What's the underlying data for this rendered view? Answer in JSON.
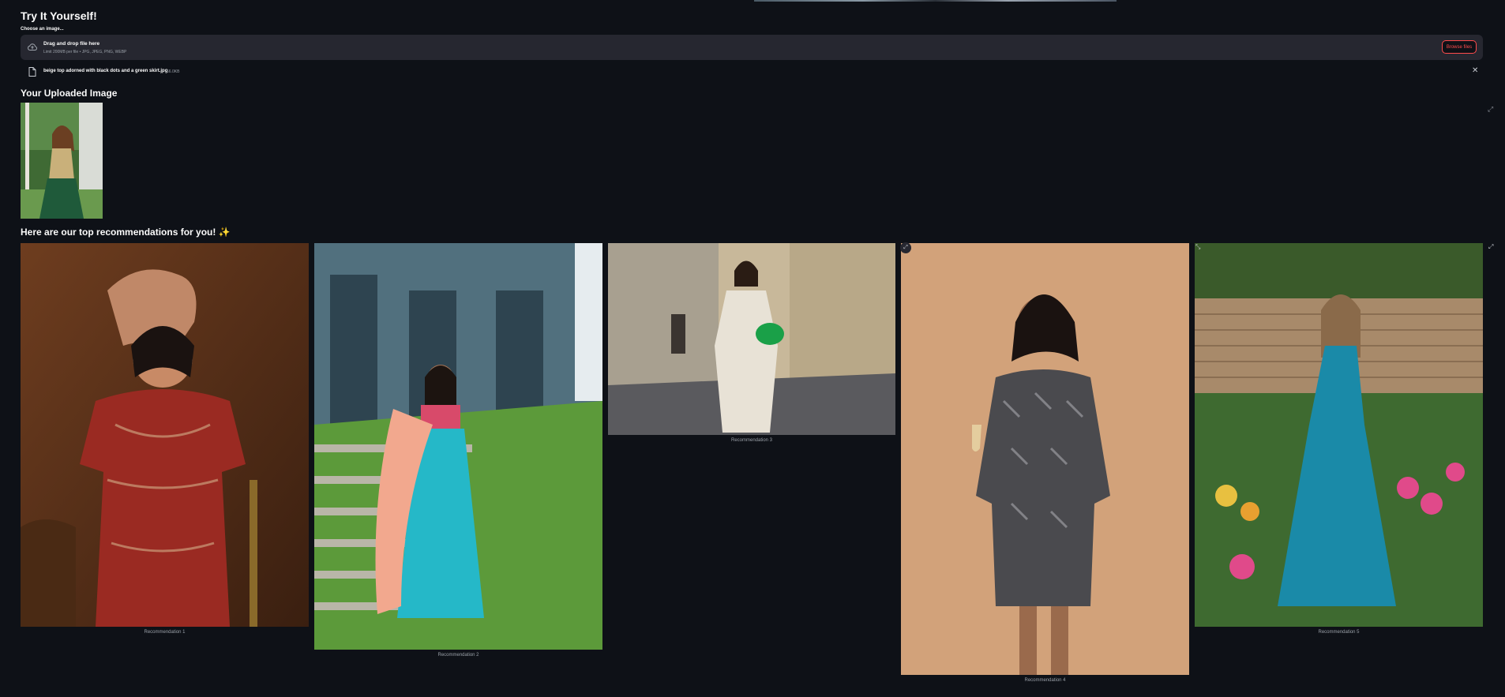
{
  "header": {
    "title": "Try It Yourself!"
  },
  "uploader": {
    "label": "Choose an image...",
    "drop_title": "Drag and drop file here",
    "drop_sub": "Limit 200MB per file • JPG, JPEG, PNG, WEBP",
    "browse_label": "Browse files",
    "file": {
      "name": "beige top adorned with black dots and a green skirt.jpg",
      "size": "56.0KB"
    },
    "close_symbol": "✕"
  },
  "uploaded": {
    "heading": "Your Uploaded Image"
  },
  "recommendations": {
    "heading": "Here are our top recommendations for you! ✨",
    "items": [
      {
        "caption": "Recommendation 1"
      },
      {
        "caption": "Recommendation 2"
      },
      {
        "caption": "Recommendation 3"
      },
      {
        "caption": "Recommendation 4"
      },
      {
        "caption": "Recommendation 5"
      }
    ]
  },
  "icons": {
    "cloud": "cloud-upload-icon",
    "file": "file-icon",
    "close": "close-icon",
    "expand": "fullscreen-icon"
  },
  "colors": {
    "background": "#0e1117",
    "panel": "#262730",
    "accent": "#ff4b4b",
    "muted_text": "#9aa0a8"
  }
}
